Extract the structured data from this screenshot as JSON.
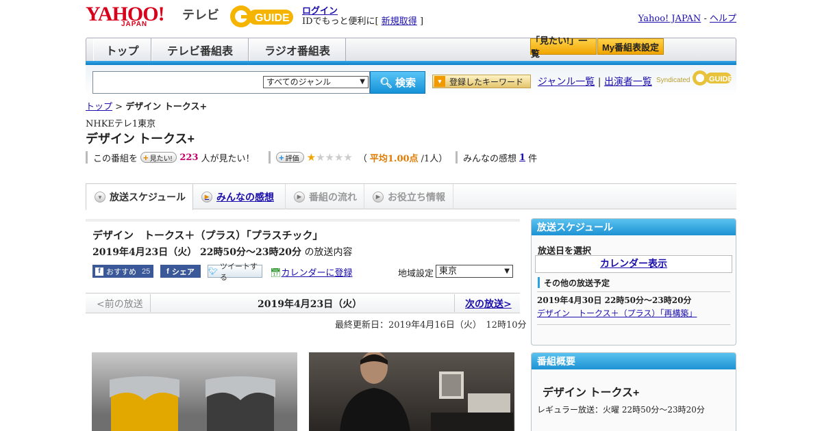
{
  "header": {
    "yahoo": "YAHOO!",
    "japan": "JAPAN",
    "tv": "テレビ",
    "gguide": "G-GUIDE",
    "login": "ログイン",
    "login_sub_prefix": "IDでもっと便利に[",
    "signup": "新規取得",
    "login_sub_suffix": "]",
    "yahoo_japan_link": "Yahoo! JAPAN",
    "help_link": "ヘルプ",
    "dash": "-"
  },
  "nav": {
    "tabs": [
      "トップ",
      "テレビ番組表",
      "ラジオ番組表"
    ],
    "want_list": "「見たい!」一覧",
    "my_schedule": "My番組表設定"
  },
  "search": {
    "genre": "すべてのジャンル",
    "button": "検索",
    "keyword_button": "登録したキーワード",
    "genre_list": "ジャンル一覧",
    "separator": "|",
    "cast_list": "出演者一覧",
    "syndicated": "Syndicated"
  },
  "breadcrumb": {
    "top": "トップ",
    "sep": ">",
    "current": "デザイン トークス+"
  },
  "program": {
    "channel": "NHKEテレ1東京",
    "title": "デザイン トークス+",
    "want_prefix": "この番組を",
    "want_pill": "見たい!",
    "want_count": "223",
    "want_suffix": "人が見たい！",
    "rating_pill": "評価",
    "rating": 1,
    "rating_open": "（",
    "rating_avg": "平均1.00点",
    "rating_people": "/1人）",
    "impressions_prefix": "みんなの感想",
    "impressions_count": "1",
    "impressions_suffix": "件"
  },
  "tabs": [
    "放送スケジュール",
    "みんなの感想",
    "番組の流れ",
    "お役立ち情報"
  ],
  "broadcast": {
    "title": "デザイン　トークス＋（プラス）「プラスチック」",
    "date_bold": "2019年4月23日（火）  22時50分～23時20分",
    "date_suffix": " の放送内容",
    "fb_recommend": "おすすめ",
    "fb_count": "25",
    "fb_share": "シェア",
    "tweet": "ツイートする",
    "calendar": "カレンダーに登録",
    "region_label": "地域設定",
    "region": "東京",
    "prev": "<前の放送",
    "current_date": "2019年4月23日（火）",
    "next": "次の放送>",
    "updated": "最終更新日：2019年4月16日（火）　12時10分"
  },
  "sidebar": {
    "schedule_head": "放送スケジュール",
    "pick_date": "放送日を選択",
    "calendar_view": "カレンダー表示",
    "other_head": "その他の放送予定",
    "other_date": "2019年4月30日  22時50分～23時20分",
    "other_link": "デザイン　トークス＋（プラス）「再構築」",
    "overview_head": "番組概要",
    "overview_title": "デザイン トークス+",
    "overview_regular": "レギュラー放送：火曜 22時50分～23時20分"
  },
  "colors": {
    "accent": "#1d92d3",
    "brand": "#d8001a",
    "gold": "#f0a500"
  }
}
